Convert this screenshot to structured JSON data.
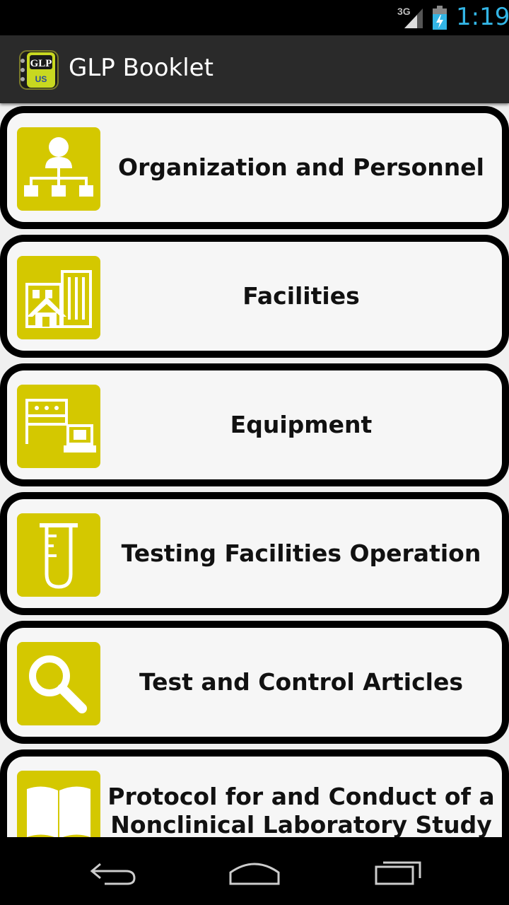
{
  "status_bar": {
    "network": "3G",
    "time": "1:19"
  },
  "app_bar": {
    "title": "GLP Booklet",
    "icon_text_top": "GLP",
    "icon_text_bottom": "US"
  },
  "menu": [
    {
      "label": "Organization and Personnel",
      "icon": "organization-chart-icon"
    },
    {
      "label": "Facilities",
      "icon": "buildings-icon"
    },
    {
      "label": "Equipment",
      "icon": "lab-equipment-icon"
    },
    {
      "label": "Testing Facilities Operation",
      "icon": "test-tube-icon"
    },
    {
      "label": "Test and Control Articles",
      "icon": "magnifier-icon"
    },
    {
      "label": "Protocol for and Conduct of a Nonclinical Laboratory Study",
      "icon": "open-book-icon"
    }
  ],
  "nav_bar": {
    "back": "back-icon",
    "home": "home-icon",
    "recents": "recent-apps-icon"
  },
  "colors": {
    "accent": "#33b5e5",
    "tile": "#d4c800",
    "card_border": "#000000"
  }
}
